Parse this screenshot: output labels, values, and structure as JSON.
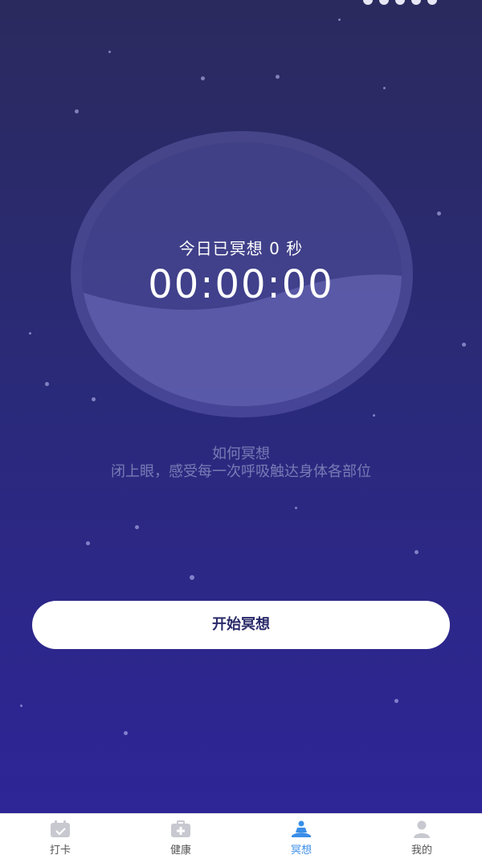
{
  "meditation": {
    "today_text": "今日已冥想 0 秒",
    "timer": "00:00:00"
  },
  "howto": {
    "title": "如何冥想",
    "text": "闭上眼，感受每一次呼吸触达身体各部位"
  },
  "start_button": {
    "label": "开始冥想"
  },
  "tabbar": {
    "tabs": [
      {
        "label": "打卡",
        "icon": "calendar-check-icon",
        "active": false
      },
      {
        "label": "健康",
        "icon": "medical-kit-icon",
        "active": false
      },
      {
        "label": "冥想",
        "icon": "meditation-icon",
        "active": true
      },
      {
        "label": "我的",
        "icon": "user-icon",
        "active": false
      }
    ]
  },
  "colors": {
    "background_top": "#2b2a5e",
    "background_bottom": "#2e2597",
    "active_tab": "#3a8ee8",
    "inactive_tab": "#c8c8d0"
  }
}
